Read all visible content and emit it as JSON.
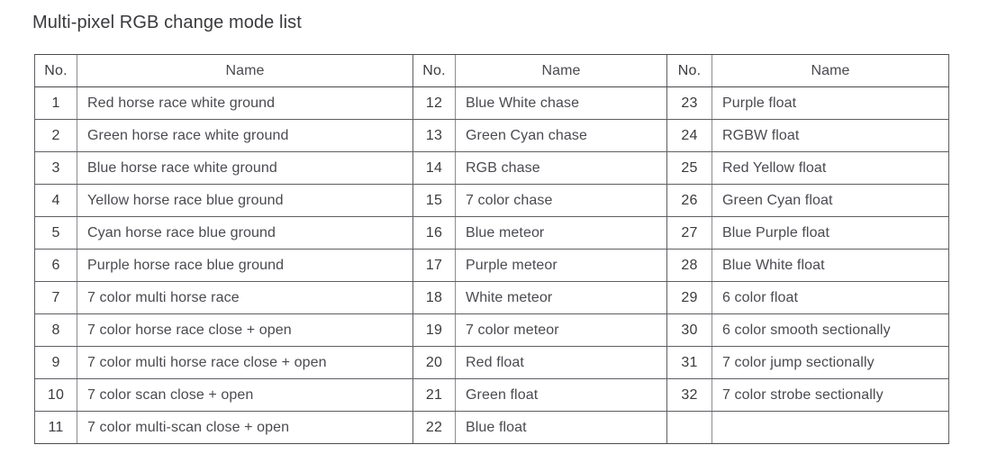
{
  "document": {
    "title": "Multi-pixel RGB change mode list"
  },
  "table": {
    "headers": {
      "no": "No.",
      "name": "Name"
    },
    "groups": [
      {
        "rows": [
          {
            "no": "1",
            "name": "Red horse race white ground"
          },
          {
            "no": "2",
            "name": "Green horse race white ground"
          },
          {
            "no": "3",
            "name": "Blue horse race white ground"
          },
          {
            "no": "4",
            "name": "Yellow horse race blue ground"
          },
          {
            "no": "5",
            "name": "Cyan horse race blue ground"
          },
          {
            "no": "6",
            "name": "Purple horse race blue ground"
          },
          {
            "no": "7",
            "name": "7 color multi horse race"
          },
          {
            "no": "8",
            "name": "7 color horse race close + open"
          },
          {
            "no": "9",
            "name": "7 color multi horse race close + open"
          },
          {
            "no": "10",
            "name": "7 color scan close + open"
          },
          {
            "no": "11",
            "name": "7 color multi-scan close + open"
          }
        ]
      },
      {
        "rows": [
          {
            "no": "12",
            "name": "Blue White chase"
          },
          {
            "no": "13",
            "name": "Green Cyan chase"
          },
          {
            "no": "14",
            "name": "RGB chase"
          },
          {
            "no": "15",
            "name": "7 color chase"
          },
          {
            "no": "16",
            "name": "Blue meteor"
          },
          {
            "no": "17",
            "name": "Purple meteor"
          },
          {
            "no": "18",
            "name": "White meteor"
          },
          {
            "no": "19",
            "name": "7 color meteor"
          },
          {
            "no": "20",
            "name": "Red float"
          },
          {
            "no": "21",
            "name": "Green float"
          },
          {
            "no": "22",
            "name": "Blue float"
          }
        ]
      },
      {
        "rows": [
          {
            "no": "23",
            "name": "Purple float"
          },
          {
            "no": "24",
            "name": "RGBW float"
          },
          {
            "no": "25",
            "name": "Red Yellow float"
          },
          {
            "no": "26",
            "name": "Green Cyan float"
          },
          {
            "no": "27",
            "name": "Blue Purple float"
          },
          {
            "no": "28",
            "name": "Blue White float"
          },
          {
            "no": "29",
            "name": "6 color float"
          },
          {
            "no": "30",
            "name": "6 color smooth sectionally"
          },
          {
            "no": "31",
            "name": "7 color jump sectionally"
          },
          {
            "no": "32",
            "name": "7 color strobe sectionally"
          },
          {
            "no": "",
            "name": ""
          }
        ]
      }
    ]
  },
  "style": {
    "border_color": "#5e5e63",
    "text_color": "#3b3b3f",
    "background": "#ffffff"
  }
}
